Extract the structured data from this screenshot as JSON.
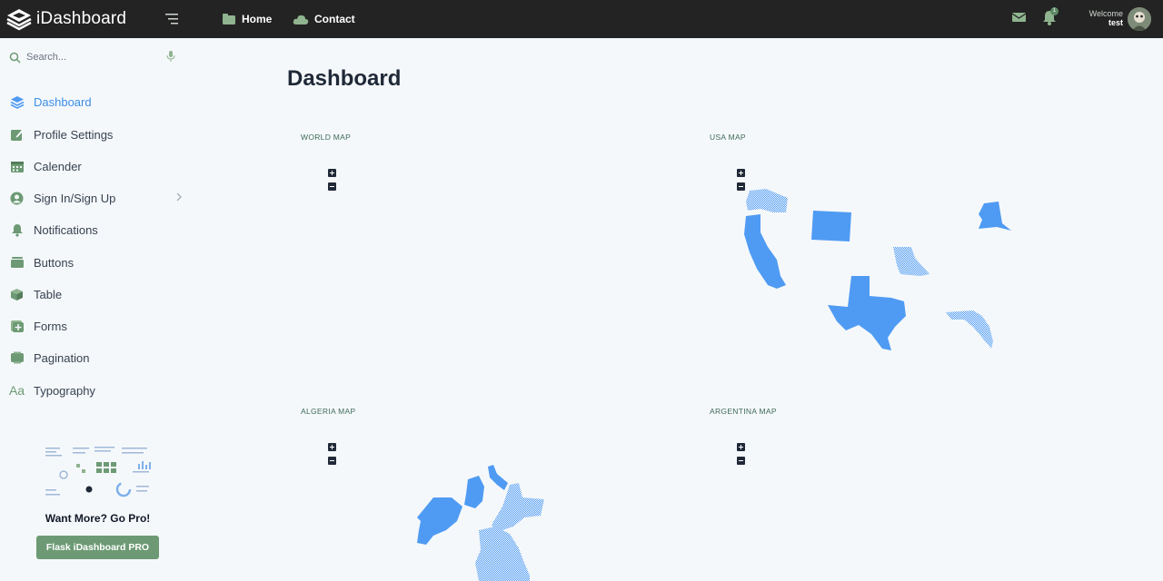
{
  "brand": {
    "name": "iDashboard"
  },
  "topnav": {
    "items": [
      {
        "label": "Home",
        "icon": "folder-icon"
      },
      {
        "label": "Contact",
        "icon": "cloud-icon"
      }
    ],
    "notification_count": "1",
    "welcome_label": "Welcome",
    "username": "test"
  },
  "sidebar": {
    "search_placeholder": "Search...",
    "items": [
      {
        "label": "Dashboard",
        "icon": "layers-icon",
        "active": true
      },
      {
        "label": "Profile Settings",
        "icon": "edit-icon"
      },
      {
        "label": "Calender",
        "icon": "calendar-icon"
      },
      {
        "label": "Sign In/Sign Up",
        "icon": "user-circle-icon"
      },
      {
        "label": "Notifications",
        "icon": "bell-icon"
      },
      {
        "label": "Buttons",
        "icon": "stack-icon"
      },
      {
        "label": "Table",
        "icon": "box-icon"
      },
      {
        "label": "Forms",
        "icon": "plus-square-icon"
      },
      {
        "label": "Pagination",
        "icon": "pages-icon"
      },
      {
        "label": "Typography",
        "icon": "text-icon"
      }
    ],
    "promo": {
      "title": "Want More? Go Pro!",
      "button": "Flask iDashboard PRO"
    }
  },
  "main": {
    "title": "Dashboard",
    "maps": [
      {
        "label": "WORLD MAP"
      },
      {
        "label": "USA MAP"
      },
      {
        "label": "ALGERIA MAP"
      },
      {
        "label": "ARGENTINA MAP"
      }
    ]
  },
  "colors": {
    "accent": "#3b8ee8",
    "region_fill": "#4f9bf3",
    "topbar": "#232323",
    "icon_green": "#6d9a74"
  }
}
